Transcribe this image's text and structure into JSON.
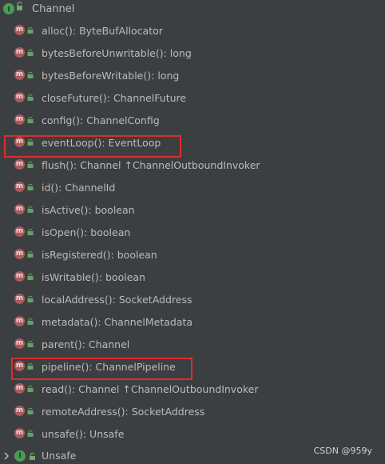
{
  "root": {
    "label": "Channel",
    "icon": "interface-icon"
  },
  "members": [
    {
      "name": "alloc()",
      "type": ": ByteBufAllocator"
    },
    {
      "name": "bytesBeforeUnwritable()",
      "type": ": long"
    },
    {
      "name": "bytesBeforeWritable()",
      "type": ": long"
    },
    {
      "name": "closeFuture()",
      "type": ": ChannelFuture"
    },
    {
      "name": "config()",
      "type": ": ChannelConfig"
    },
    {
      "name": "eventLoop()",
      "type": ": EventLoop",
      "highlighted": true
    },
    {
      "name": "flush()",
      "type": ": Channel ↑ChannelOutboundInvoker"
    },
    {
      "name": "id()",
      "type": ": ChannelId"
    },
    {
      "name": "isActive()",
      "type": ": boolean"
    },
    {
      "name": "isOpen()",
      "type": ": boolean"
    },
    {
      "name": "isRegistered()",
      "type": ": boolean"
    },
    {
      "name": "isWritable()",
      "type": ": boolean"
    },
    {
      "name": "localAddress()",
      "type": ": SocketAddress"
    },
    {
      "name": "metadata()",
      "type": ": ChannelMetadata"
    },
    {
      "name": "parent()",
      "type": ": Channel"
    },
    {
      "name": "pipeline()",
      "type": ": ChannelPipeline",
      "highlighted": true
    },
    {
      "name": "read()",
      "type": ": Channel ↑ChannelOutboundInvoker"
    },
    {
      "name": "remoteAddress()",
      "type": ": SocketAddress"
    },
    {
      "name": "unsafe()",
      "type": ": Unsafe"
    }
  ],
  "nested": {
    "label": "Unsafe",
    "icon": "interface-icon"
  },
  "watermark": "CSDN @959y",
  "colors": {
    "highlight_border": "#e02b2b",
    "method_icon": "#a95a5a",
    "interface_icon": "#499c54"
  }
}
